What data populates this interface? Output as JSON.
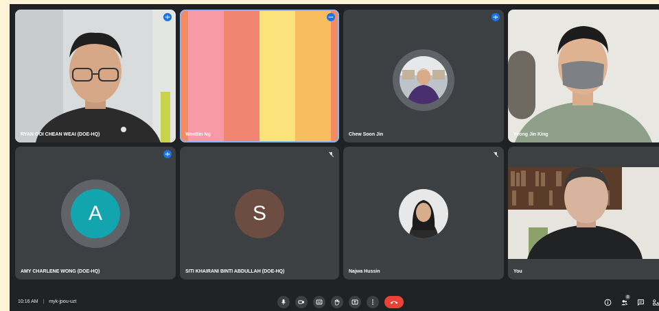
{
  "participants": [
    {
      "name": "RYAN OOI CHEAN WEAI (DOE-HQ)",
      "status_icon": "speaking-icon"
    },
    {
      "name": "WeeBin Ng",
      "status_icon": "more-options-icon"
    },
    {
      "name": "Chew Soon Jin",
      "status_icon": "speaking-icon"
    },
    {
      "name": "Yeong Jin King",
      "status_icon": ""
    },
    {
      "name": "AMY CHARLENE WONG (DOE-HQ)",
      "status_icon": "speaking-icon",
      "initial": "A",
      "avatar_color": "#12a4af"
    },
    {
      "name": "SITI KHAIRANI BINTI ABDULLAH (DOE-HQ)",
      "status_icon": "mic-off-icon",
      "initial": "S",
      "avatar_color": "#6d4c41"
    },
    {
      "name": "Najwa Hussin",
      "status_icon": "mic-off-icon"
    },
    {
      "name": "You",
      "status_icon": ""
    }
  ],
  "footer": {
    "time": "10:16 AM",
    "separator": "|",
    "meeting_code": "myk-jpou-uzt",
    "people_count": "8"
  },
  "colors": {
    "accent": "#1a73e8",
    "end_call": "#ea4335",
    "stripes": [
      "#f28b60",
      "#f79aa5",
      "#f28472",
      "#fbe27a",
      "#f8bd5f"
    ]
  }
}
